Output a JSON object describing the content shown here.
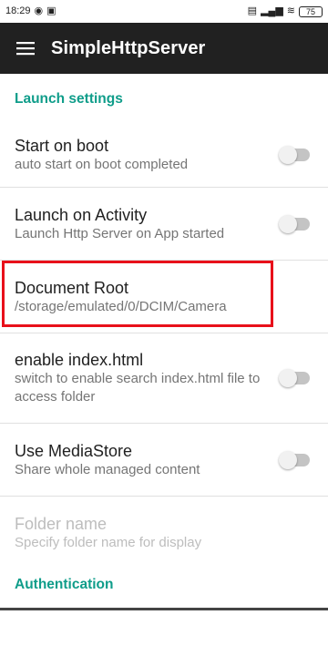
{
  "status_bar": {
    "time": "18:29",
    "left_icons": [
      "screen-record-icon",
      "notification-icon"
    ],
    "battery": "75"
  },
  "app_bar": {
    "title": "SimpleHttpServer",
    "menu_icon": "hamburger-menu-icon",
    "background": "#212121"
  },
  "sections": {
    "launch": {
      "header": "Launch settings"
    },
    "auth": {
      "header": "Authentication"
    }
  },
  "prefs": [
    {
      "title": "Start on boot",
      "summary": "auto start on boot completed",
      "switch": "off"
    },
    {
      "title": "Launch on Activity",
      "summary": "Launch Http Server on App started",
      "switch": "off"
    },
    {
      "title": "Document Root",
      "summary": "/storage/emulated/0/DCIM/Camera"
    },
    {
      "title": "enable index.html",
      "summary": "switch to enable search index.html file to access folder",
      "switch": "off"
    },
    {
      "title": "Use MediaStore",
      "summary": "Share whole managed content",
      "switch": "off"
    },
    {
      "title": "Folder name",
      "summary": "Specify folder name for display",
      "enabled": false
    }
  ],
  "colors": {
    "accent": "#0f9d8a",
    "highlight": "#e8101a"
  }
}
